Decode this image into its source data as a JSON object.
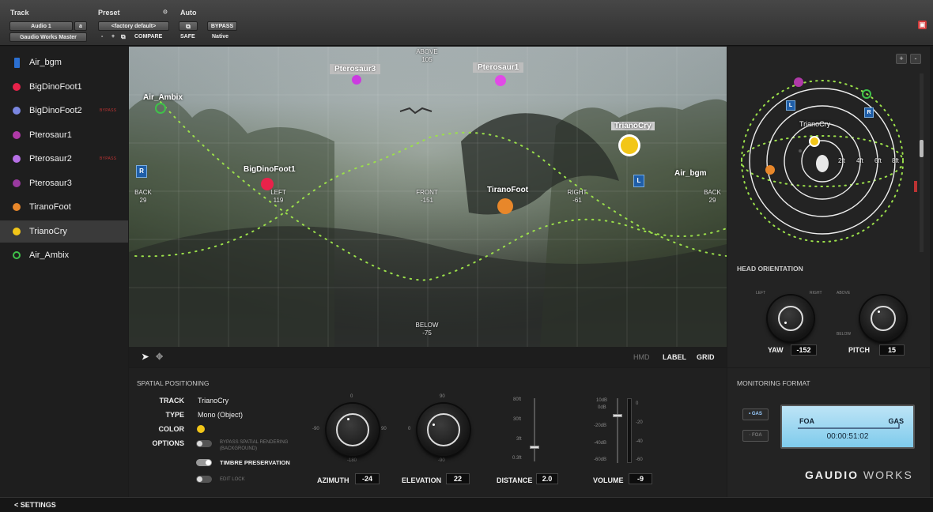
{
  "topbar": {
    "track_label": "Track",
    "preset_label": "Preset",
    "auto_label": "Auto",
    "track_select": "Audio 1",
    "track_letter": "a",
    "preset_select": "<factory default>",
    "output_select": "Gaudio Works Master",
    "compare": "COMPARE",
    "safe": "SAFE",
    "bypass": "BYPASS",
    "native": "Native",
    "minus": "-",
    "plus": "+"
  },
  "tracks": [
    {
      "name": "Air_bgm",
      "color": "#2b6fd1",
      "shape": "bar",
      "bypass": ""
    },
    {
      "name": "BigDinoFoot1",
      "color": "#e8224a",
      "shape": "dot",
      "bypass": ""
    },
    {
      "name": "BigDinoFoot2",
      "color": "#7a86e0",
      "shape": "dot",
      "bypass": "BYPASS"
    },
    {
      "name": "Pterosaur1",
      "color": "#b03aa8",
      "shape": "dot",
      "bypass": ""
    },
    {
      "name": "Pterosaur2",
      "color": "#b770e6",
      "shape": "dot",
      "bypass": "BYPASS"
    },
    {
      "name": "Pterosaur3",
      "color": "#9a3aa0",
      "shape": "dot",
      "bypass": ""
    },
    {
      "name": "TiranoFoot",
      "color": "#e8872a",
      "shape": "dot",
      "bypass": ""
    },
    {
      "name": "TrianoCry",
      "color": "#f2c618",
      "shape": "dot",
      "bypass": ""
    },
    {
      "name": "Air_Ambix",
      "color": "#3fc24a",
      "shape": "ring",
      "bypass": ""
    }
  ],
  "selected_track": "TrianoCry",
  "panorama": {
    "above": "ABOVE",
    "above_val": "105",
    "below": "BELOW",
    "below_val": "-75",
    "back": "BACK",
    "back_val_left": "29",
    "back_val_right": "29",
    "left": "LEFT",
    "left_val": "119",
    "front": "FRONT",
    "front_val": "-151",
    "right": "RIGHT",
    "right_val": "-61",
    "objects": {
      "pterosaur3": "Pterosaur3",
      "pterosaur1": "Pterosaur1",
      "air_ambix": "Air_Ambix",
      "bigdinofoot1": "BigDinoFoot1",
      "trianocry": "TrianoCry",
      "tiranofoot": "TiranoFoot",
      "air_bgm": "Air_bgm"
    },
    "r_marker": "R",
    "l_marker": "L"
  },
  "pano_tools": {
    "hmd": "HMD",
    "label": "LABEL",
    "grid": "GRID"
  },
  "head": {
    "title": "HEAD ORIENTATION",
    "left": "LEFT",
    "right": "RIGHT",
    "above": "ABOVE",
    "below": "BELOW",
    "yaw_label": "YAW",
    "yaw": "-152",
    "pitch_label": "PITCH",
    "pitch": "15"
  },
  "topview": {
    "selected": "TrianoCry",
    "r2": "2ft",
    "r4": "4ft",
    "r6": "6ft",
    "r8": "8ft",
    "l_marker": "L",
    "r_marker": "R",
    "plus": "+",
    "minus": "-"
  },
  "spatial": {
    "title": "SPATIAL POSITIONING",
    "track_label": "TRACK",
    "track": "TrianoCry",
    "type_label": "TYPE",
    "type": "Mono (Object)",
    "color_label": "COLOR",
    "color": "#f2c618",
    "options_label": "OPTIONS",
    "opt1": "BYPASS SPATIAL RENDERING (BACKGROUND)",
    "opt2": "TIMBRE PRESERVATION",
    "opt3": "EDIT LOCK",
    "az_label": "AZIMUTH",
    "azimuth": "-24",
    "az_top": "0",
    "az_left": "-90",
    "az_right": "90",
    "az_bottom": "-180",
    "el_label": "ELEVATION",
    "elevation": "22",
    "el_top": "90",
    "el_left": "0",
    "el_bottom": "-90",
    "dist_label": "DISTANCE",
    "distance": "2.0",
    "d_top": "80ft",
    "d_mid": "30ft",
    "d_low": "3ft",
    "d_bot": "0.3ft",
    "vol_label": "VOLUME",
    "volume": "-9",
    "v_10": "10dB",
    "v_0": "0dB",
    "v_20": "-20dB",
    "v_40": "-40dB",
    "v_60": "-60dB",
    "m_0": "0",
    "m_20": "-20",
    "m_40": "-40",
    "m_60": "-60"
  },
  "monitoring": {
    "title": "MONITORING FORMAT",
    "gas_btn": "• GAS",
    "foa_btn": "· FOA",
    "lcd_left": "FOA",
    "lcd_right": "GAS",
    "time": "00:00:51:02",
    "logo_a": "GAUDIO",
    "logo_b": "WORKS"
  },
  "footer": {
    "settings": "< SETTINGS"
  }
}
